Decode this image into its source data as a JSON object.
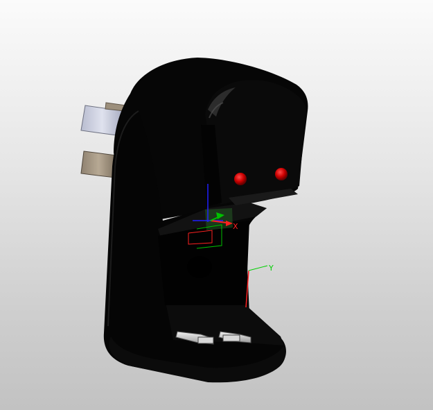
{
  "viewport": {
    "background_top": "#fbfbfb",
    "background_bottom": "#c2c2c2"
  },
  "model": {
    "body_color": "#050505",
    "highlight_color": "#3a3a3a",
    "led_color": "#cc0000",
    "pin_top_color": "#c9ccdc",
    "pin_bottom_color": "#a89a88",
    "led_count": 2
  },
  "triad": {
    "x_label": "X",
    "x_color": "#ff2020",
    "y_color": "#00c000",
    "z_color": "#2020ff"
  },
  "part_axis": {
    "y_label": "Y",
    "y_color": "#00d000",
    "x_color": "#ff2020"
  }
}
